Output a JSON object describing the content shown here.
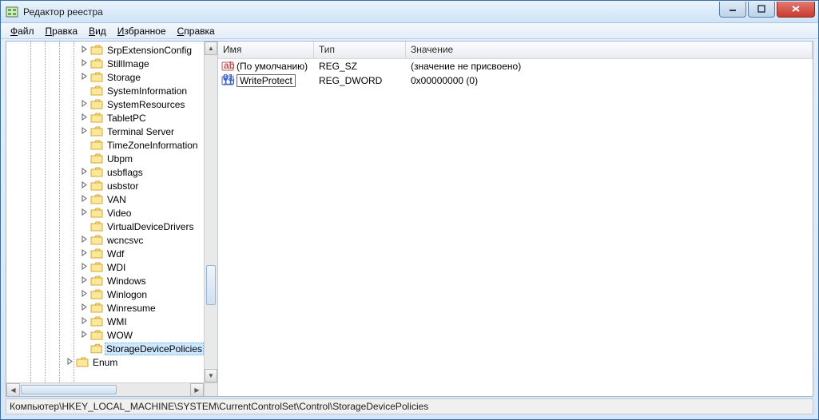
{
  "window": {
    "title": "Редактор реестра"
  },
  "menu": {
    "file": {
      "label": "Файл",
      "ukey": "Ф"
    },
    "edit": {
      "label": "Правка",
      "ukey": "П"
    },
    "view": {
      "label": "Вид",
      "ukey": "В"
    },
    "fav": {
      "label": "Избранное",
      "ukey": "И"
    },
    "help": {
      "label": "Справка",
      "ukey": "С"
    }
  },
  "tree": {
    "items": [
      {
        "label": "SrpExtensionConfig",
        "expandable": true,
        "selected": false
      },
      {
        "label": "StillImage",
        "expandable": true,
        "selected": false
      },
      {
        "label": "Storage",
        "expandable": true,
        "selected": false
      },
      {
        "label": "SystemInformation",
        "expandable": false,
        "selected": false
      },
      {
        "label": "SystemResources",
        "expandable": true,
        "selected": false
      },
      {
        "label": "TabletPC",
        "expandable": true,
        "selected": false
      },
      {
        "label": "Terminal Server",
        "expandable": true,
        "selected": false
      },
      {
        "label": "TimeZoneInformation",
        "expandable": false,
        "selected": false
      },
      {
        "label": "Ubpm",
        "expandable": false,
        "selected": false
      },
      {
        "label": "usbflags",
        "expandable": true,
        "selected": false
      },
      {
        "label": "usbstor",
        "expandable": true,
        "selected": false
      },
      {
        "label": "VAN",
        "expandable": true,
        "selected": false
      },
      {
        "label": "Video",
        "expandable": true,
        "selected": false
      },
      {
        "label": "VirtualDeviceDrivers",
        "expandable": false,
        "selected": false
      },
      {
        "label": "wcncsvc",
        "expandable": true,
        "selected": false
      },
      {
        "label": "Wdf",
        "expandable": true,
        "selected": false
      },
      {
        "label": "WDI",
        "expandable": true,
        "selected": false
      },
      {
        "label": "Windows",
        "expandable": true,
        "selected": false
      },
      {
        "label": "Winlogon",
        "expandable": true,
        "selected": false
      },
      {
        "label": "Winresume",
        "expandable": true,
        "selected": false
      },
      {
        "label": "WMI",
        "expandable": true,
        "selected": false
      },
      {
        "label": "WOW",
        "expandable": true,
        "selected": false
      },
      {
        "label": "StorageDevicePolicies",
        "expandable": false,
        "selected": true
      }
    ],
    "next": {
      "label": "Enum",
      "expandable": true
    }
  },
  "list": {
    "headers": {
      "name": "Имя",
      "type": "Тип",
      "value": "Значение"
    },
    "rows": [
      {
        "icon": "sz",
        "name": "(По умолчанию)",
        "type": "REG_SZ",
        "value": "(значение не присвоено)",
        "selected": false
      },
      {
        "icon": "dword",
        "name": "WriteProtect",
        "type": "REG_DWORD",
        "value": "0x00000000 (0)",
        "selected": true
      }
    ]
  },
  "statusbar": {
    "path": "Компьютер\\HKEY_LOCAL_MACHINE\\SYSTEM\\CurrentControlSet\\Control\\StorageDevicePolicies"
  }
}
